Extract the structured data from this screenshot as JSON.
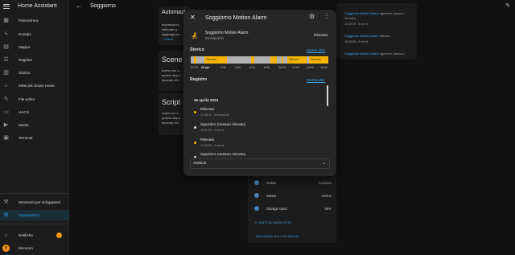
{
  "app": {
    "title": "Home Assistant"
  },
  "header": {
    "page_title": "Soggiorno"
  },
  "sidebar": {
    "items": [
      {
        "label": "Panoramica",
        "icon": "dashboard-icon"
      },
      {
        "label": "Energia",
        "icon": "lightning-icon"
      },
      {
        "label": "Mappa",
        "icon": "map-icon"
      },
      {
        "label": "Registro",
        "icon": "list-icon"
      },
      {
        "label": "Storico",
        "icon": "chart-icon"
      },
      {
        "label": "eWeLink Smart Home",
        "icon": "home-icon"
      },
      {
        "label": "File editor",
        "icon": "wrench-icon"
      },
      {
        "label": "HACS",
        "icon": "hacs-icon"
      },
      {
        "label": "Media",
        "icon": "media-icon"
      },
      {
        "label": "Terminal",
        "icon": "terminal-icon"
      }
    ],
    "dev_tools": "Strumenti per sviluppatori",
    "settings": "Impostazioni",
    "notifications": "Notifiche",
    "user": "Vincenzo",
    "user_initial": "V"
  },
  "bg": {
    "card1_title": "Automazioni",
    "card1_text": [
      "automazioni...",
      "utilizzate q...",
      "aggiungerne...",
      "+ scena"
    ],
    "card2_title": "Scene",
    "card2_text": [
      "scene con a...",
      "questo dispo...",
      "facendo clic..."
    ],
    "card3_title": "Script",
    "card3_text": [
      "script con a...",
      "questo dispo...",
      "facendo clic..."
    ],
    "right_log": [
      {
        "a": "Soggiorno Motion Alarm",
        "b": " sgombro (nessun",
        "c": "rilevato)",
        "d": "16:40:19 - 5 ore fa"
      },
      {
        "a": "Soggiorno Motion Alarm",
        "b": " rilevato",
        "c": "",
        "d": "16:39:59 - 5 ore fa"
      },
      {
        "a": "Soggiorno Motion Alarm",
        "b": " sgombro (nessun",
        "c": "",
        "d": ""
      }
    ],
    "info_rows": [
      {
        "k": "Online",
        "v": "Accesso",
        "icon": "cloud-icon"
      },
      {
        "k": "Status",
        "v": "Online",
        "icon": "status-icon"
      },
      {
        "k": "Storage used",
        "v": "98%",
        "icon": "storage-icon"
      }
    ],
    "more_entities": "+1 ENTITÀ NASCOSTA",
    "add_dashboard": "AGGIUNGI ALLA PLANCIA"
  },
  "dialog": {
    "title": "Soggiorno Motion Alarm",
    "entity_name": "Soggiorno Motion Alarm",
    "entity_time": "26 minuti fa",
    "entity_state": "Rilevato",
    "history_title": "Storico",
    "show_more": "Mostra altro",
    "history_segment_label": "Rilevato",
    "history_ticks": [
      "22:00",
      "26 apr",
      "2:00",
      "4:00",
      "6:00",
      "8:00",
      "10:00",
      "12:00",
      "14:00",
      "16:00",
      "18:00"
    ],
    "log_title": "Registro",
    "log_date": "26 aprile 2023",
    "log_items": [
      {
        "title": "Rilevato",
        "sub": "21:38:11 - 26 minuti fa",
        "color": "#f4b400"
      },
      {
        "title": "Sgombro (nessun rilevato)",
        "sub": "18:11:33 - 3 ore fa",
        "color": "#e1e1e1"
      },
      {
        "title": "Rilevato",
        "sub": "17:26:33 - 4 ore fa",
        "color": "#f4b400"
      },
      {
        "title": "Sgombro (nessun rilevato)",
        "sub": "16:40:19 - 5 ore fa",
        "color": "#e1e1e1"
      }
    ],
    "attributes": "Attributi"
  },
  "colors": {
    "accent": "#03a9f4",
    "detected": "#f4b400",
    "clear": "#b0b0b0"
  }
}
